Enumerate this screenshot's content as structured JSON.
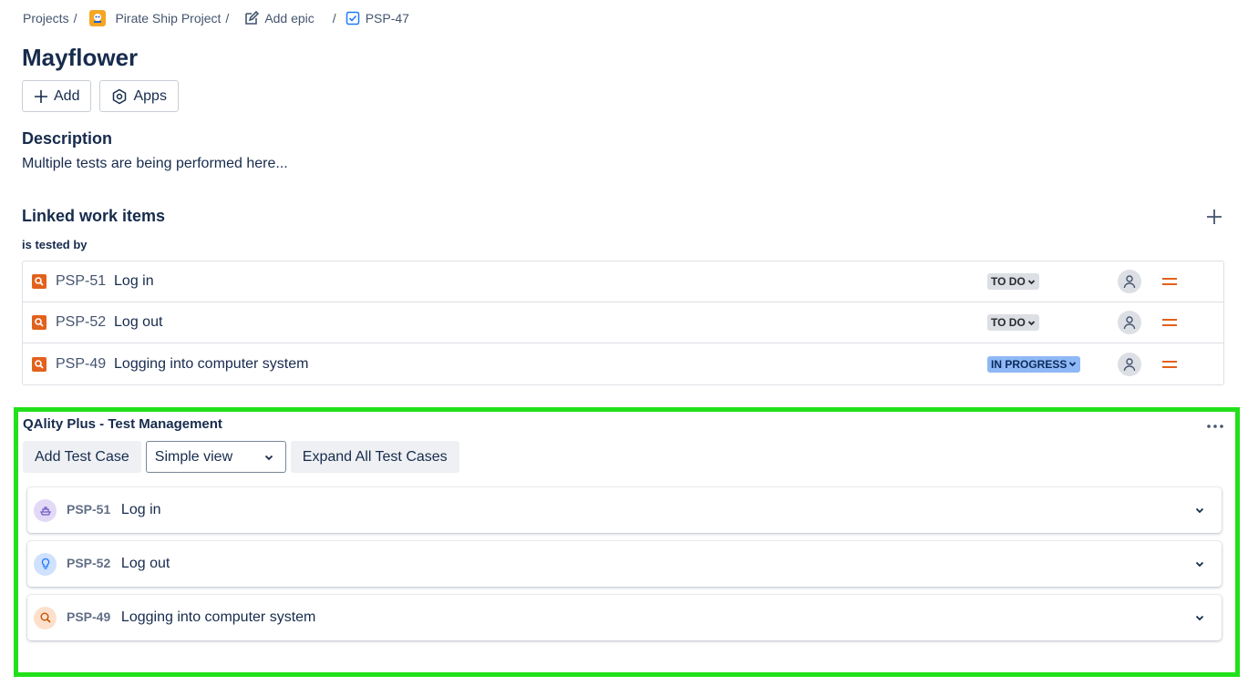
{
  "breadcrumb": {
    "projects": "Projects",
    "project": "Pirate Ship Project",
    "epic": "Add epic",
    "issue": "PSP-47",
    "separator": "/"
  },
  "page": {
    "title": "Mayflower",
    "add_label": "Add",
    "apps_label": "Apps"
  },
  "description": {
    "heading": "Description",
    "text": "Multiple tests are being performed here..."
  },
  "linked": {
    "heading": "Linked work items",
    "relation": "is tested by",
    "items": [
      {
        "key": "PSP-51",
        "summary": "Log in",
        "status": "TO DO",
        "status_type": "todo",
        "priority": "medium"
      },
      {
        "key": "PSP-52",
        "summary": "Log out",
        "status": "TO DO",
        "status_type": "todo",
        "priority": "medium"
      },
      {
        "key": "PSP-49",
        "summary": "Logging into computer system",
        "status": "IN PROGRESS",
        "status_type": "inprog",
        "priority": "medium"
      }
    ]
  },
  "qality": {
    "title": "QAlity Plus - Test Management",
    "add_test_case": "Add Test Case",
    "view_select": "Simple view",
    "expand_all": "Expand All Test Cases",
    "test_cases": [
      {
        "key": "PSP-51",
        "summary": "Log in",
        "icon": "ship-icon",
        "icon_color": "#e2d9f7"
      },
      {
        "key": "PSP-52",
        "summary": "Log out",
        "icon": "lightbulb-icon",
        "icon_color": "#cfe1fd"
      },
      {
        "key": "PSP-49",
        "summary": "Logging into computer system",
        "icon": "search-icon",
        "icon_color": "#fde0cc"
      }
    ]
  },
  "colors": {
    "highlight": "#22e01a",
    "bug_orange": "#e2611c",
    "priority_medium": "#e2611c"
  }
}
